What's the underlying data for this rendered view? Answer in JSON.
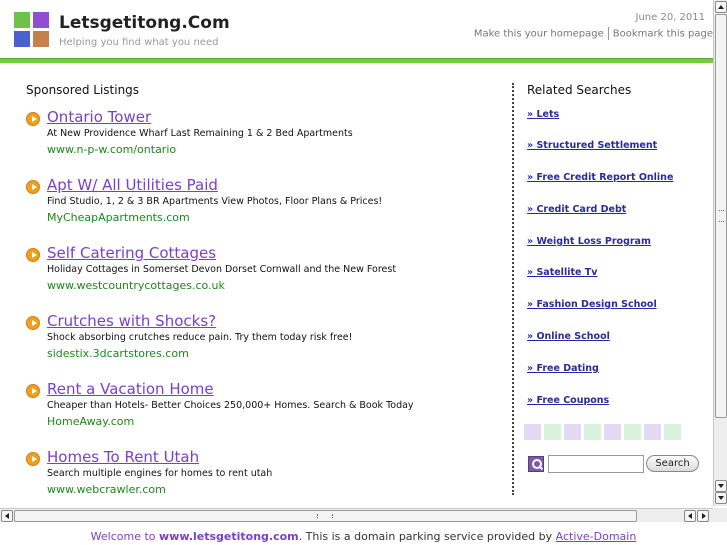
{
  "header": {
    "site_title": "Letsgetitong.Com",
    "tagline": "Helping you find what you need",
    "date": "June 20, 2011",
    "links": [
      "Make this your homepage",
      "Bookmark this page"
    ]
  },
  "sponsored": {
    "title": "Sponsored Listings",
    "listings": [
      {
        "title": "Ontario Tower",
        "desc": "At New Providence Wharf Last Remaining 1 & 2 Bed Apartments",
        "url": "www.n-p-w.com/ontario"
      },
      {
        "title": "Apt W/ All Utilities Paid",
        "desc": "Find Studio, 1, 2 & 3 BR Apartments View Photos, Floor Plans & Prices!",
        "url": "MyCheapApartments.com"
      },
      {
        "title": "Self Catering Cottages",
        "desc": "Holiday Cottages in Somerset Devon Dorset Cornwall and the New Forest",
        "url": "www.westcountrycottages.co.uk"
      },
      {
        "title": "Crutches with Shocks?",
        "desc": "Shock absorbing crutches reduce pain. Try them today risk free!",
        "url": "sidestix.3dcartstores.com"
      },
      {
        "title": "Rent a Vacation Home",
        "desc": "Cheaper than Hotels- Better Choices 250,000+ Homes. Search & Book Today",
        "url": "HomeAway.com"
      },
      {
        "title": "Homes To Rent Utah",
        "desc": "Search multiple engines for homes to rent utah",
        "url": "www.webcrawler.com"
      }
    ]
  },
  "related": {
    "title": "Related Searches",
    "items": [
      "» Lets",
      "» Structured Settlement",
      "» Free Credit Report Online",
      "» Credit Card Debt",
      "» Weight Loss Program",
      "» Satellite Tv",
      "» Fashion Design School",
      "» Online School",
      "» Free Dating",
      "» Free Coupons"
    ],
    "swatch_colors": [
      "#e4d9f2",
      "#d9f2dc",
      "#e4d9f2",
      "#d9f2dc",
      "#e4d9f2",
      "#d9f2dc",
      "#e4d9f2",
      "#d9f2dc"
    ]
  },
  "search": {
    "button_label": "Search",
    "value": "",
    "icon": "search-icon"
  },
  "footer": {
    "part1": "Welcome to ",
    "part2": "www.letsgetitong.com",
    "part3": ". This is a domain parking service provided by ",
    "part4": "Active-Domain"
  },
  "colors": {
    "accent_bar": "#7ac943",
    "link_purple": "#7b3fc9",
    "url_green": "#1a8a1a",
    "related_link": "#2a2a9a"
  }
}
